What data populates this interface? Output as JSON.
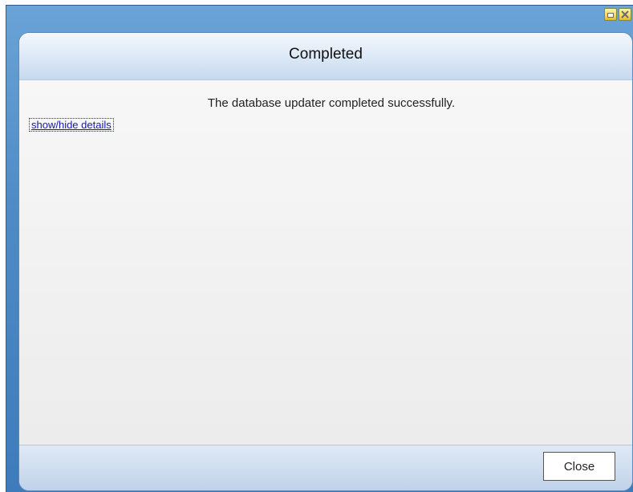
{
  "window": {
    "controls": [
      "minimize-icon",
      "close-icon"
    ]
  },
  "dialog": {
    "title": "Completed",
    "message": "The database updater completed successfully.",
    "details_link": "show/hide details",
    "close_label": "Close"
  },
  "colors": {
    "frame_blue": "#4f8cc6",
    "header_light": "#dde9f6",
    "body_grey": "#ececec",
    "link_blue": "#1a1aa8"
  }
}
